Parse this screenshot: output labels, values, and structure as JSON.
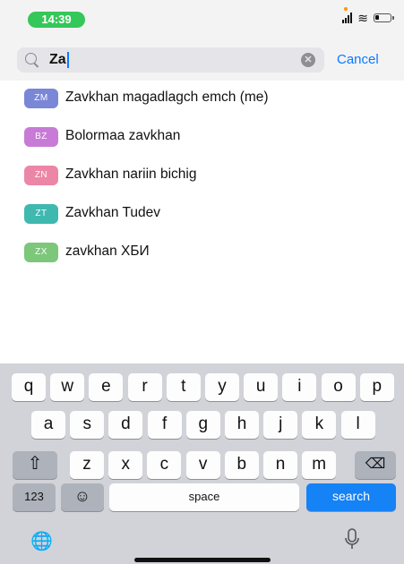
{
  "status_bar": {
    "time": "14:39",
    "battery_level": 0.25
  },
  "search": {
    "query": "Za",
    "cancel_label": "Cancel"
  },
  "results": [
    {
      "initials": "ZM",
      "name": "Zavkhan magadlagch emch (me)",
      "color": "#7a86d6"
    },
    {
      "initials": "BZ",
      "name": "Bolormaa zavkhan",
      "color": "#c77bd6"
    },
    {
      "initials": "ZN",
      "name": "Zavkhan nariin bichig",
      "color": "#ec86a6"
    },
    {
      "initials": "ZT",
      "name": "Zavkhan Tudev",
      "color": "#3fb8b0"
    },
    {
      "initials": "ZX",
      "name": "zavkhan ХБИ",
      "color": "#7cc77a"
    }
  ],
  "keyboard": {
    "row1": [
      "q",
      "w",
      "e",
      "r",
      "t",
      "y",
      "u",
      "i",
      "o",
      "p"
    ],
    "row2": [
      "a",
      "s",
      "d",
      "f",
      "g",
      "h",
      "j",
      "k",
      "l"
    ],
    "row3": [
      "z",
      "x",
      "c",
      "v",
      "b",
      "n",
      "m"
    ],
    "numbers_label": "123",
    "space_label": "space",
    "search_label": "search"
  }
}
